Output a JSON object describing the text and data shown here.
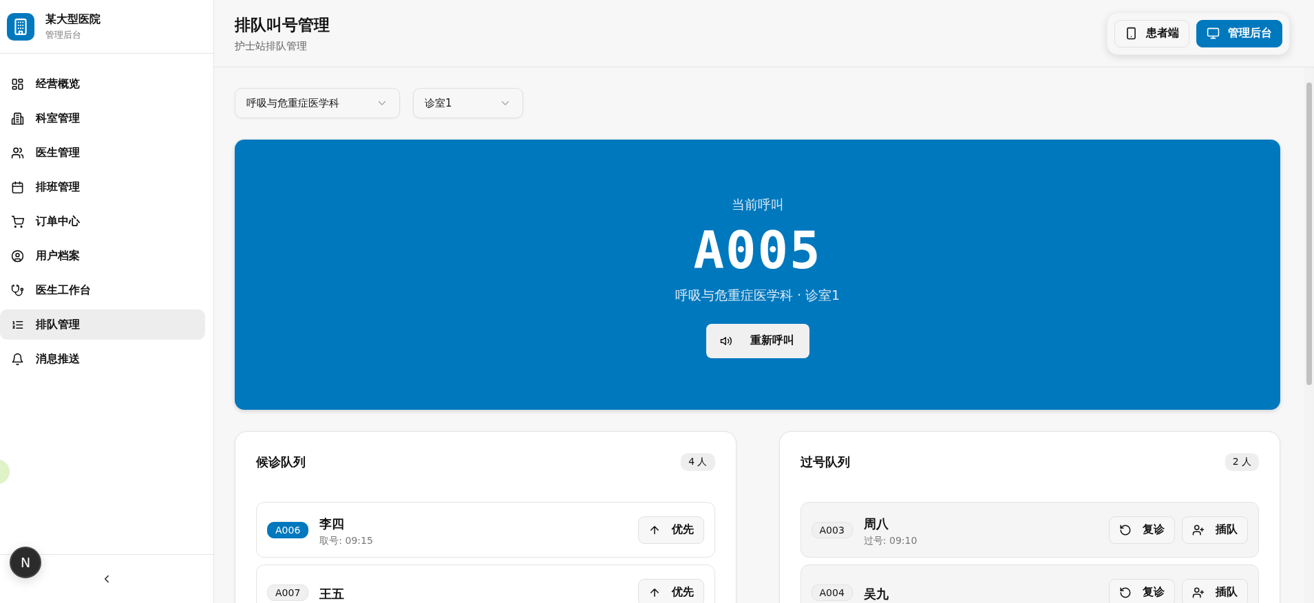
{
  "sidebar": {
    "brand": {
      "name": "某大型医院",
      "subtitle": "管理后台"
    },
    "items": [
      {
        "label": "经营概览",
        "kind": "grid",
        "selected": false
      },
      {
        "label": "科室管理",
        "kind": "building",
        "selected": false
      },
      {
        "label": "医生管理",
        "kind": "users",
        "selected": false
      },
      {
        "label": "排班管理",
        "kind": "calendar",
        "selected": false
      },
      {
        "label": "订单中心",
        "kind": "cart",
        "selected": false
      },
      {
        "label": "用户档案",
        "kind": "profile",
        "selected": false
      },
      {
        "label": "医生工作台",
        "kind": "stethoscope",
        "selected": false
      },
      {
        "label": "排队管理",
        "kind": "list",
        "selected": true
      },
      {
        "label": "消息推送",
        "kind": "bell",
        "selected": false
      }
    ],
    "dev_badge": "N"
  },
  "header": {
    "title": "排队叫号管理",
    "subtitle": "护士站排队管理",
    "view_switch": [
      {
        "label": "患者端",
        "kind": "phone",
        "selected": false
      },
      {
        "label": "管理后台",
        "kind": "monitor",
        "selected": true
      }
    ]
  },
  "filters": [
    {
      "value": "呼吸与危重症医学科"
    },
    {
      "value": "诊室1"
    }
  ],
  "current_call": {
    "label": "当前呼叫",
    "number": "A005",
    "location": "呼吸与危重症医学科 · 诊室1",
    "button": "重新呼叫"
  },
  "queues": [
    {
      "title": "候诊队列",
      "count": "4 人",
      "kind": "waiting",
      "entries": [
        {
          "number": "A006",
          "name": "李四",
          "time": "取号: 09:15",
          "highlighted": true,
          "actions": [
            {
              "label": "优先",
              "kind": "up"
            }
          ]
        },
        {
          "number": "A007",
          "name": "王五",
          "highlighted": false,
          "actions": [
            {
              "label": "优先",
              "kind": "up"
            }
          ]
        }
      ]
    },
    {
      "title": "过号队列",
      "count": "2 人",
      "kind": "missed",
      "entries": [
        {
          "number": "A003",
          "name": "周八",
          "time": "过号: 09:10",
          "highlighted": false,
          "actions": [
            {
              "label": "复诊",
              "kind": "redo"
            },
            {
              "label": "插队",
              "kind": "insert"
            }
          ]
        },
        {
          "number": "A004",
          "name": "吴九",
          "highlighted": false,
          "actions": [
            {
              "label": "复诊",
              "kind": "redo"
            },
            {
              "label": "插队",
              "kind": "insert"
            }
          ]
        }
      ]
    }
  ]
}
